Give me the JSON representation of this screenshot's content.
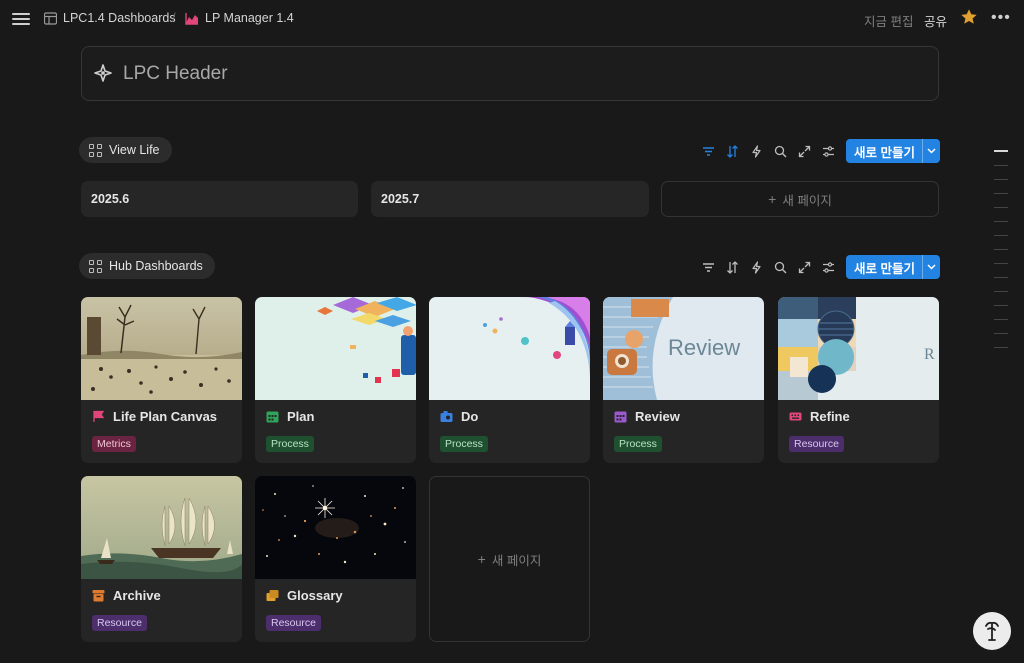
{
  "topbar": {
    "breadcrumb_1": "LPC1.4 Dashboards",
    "breadcrumb_sep": "/",
    "breadcrumb_2": "LP Manager 1.4",
    "edited_label": "지금 편집",
    "share_label": "공유",
    "more_label": "•••"
  },
  "header": {
    "title": "LPC Header"
  },
  "view_life": {
    "title": "View Life",
    "new_button": "새로 만들기",
    "cards": [
      {
        "label": "2025.6"
      },
      {
        "label": "2025.7"
      }
    ],
    "new_page": "새 페이지"
  },
  "hub": {
    "title": "Hub Dashboards",
    "new_button": "새로 만들기",
    "cards": [
      {
        "title": "Life Plan Canvas",
        "tag": "Metrics",
        "icon": "flag-icon",
        "icon_color": "#e0457b"
      },
      {
        "title": "Plan",
        "tag": "Process",
        "icon": "calendar-icon",
        "icon_color": "#2fa55c"
      },
      {
        "title": "Do",
        "tag": "Process",
        "icon": "camera-icon",
        "icon_color": "#3a80e0"
      },
      {
        "title": "Review",
        "tag": "Process",
        "icon": "calendar-icon",
        "icon_color": "#9b59d0"
      },
      {
        "title": "Refine",
        "tag": "Resource",
        "icon": "keyboard-icon",
        "icon_color": "#e0457b"
      },
      {
        "title": "Archive",
        "tag": "Resource",
        "icon": "archive-icon",
        "icon_color": "#e07a2f"
      },
      {
        "title": "Glossary",
        "tag": "Resource",
        "icon": "folder-icon",
        "icon_color": "#e0a02f"
      }
    ],
    "review_thumb_text": "Review",
    "refine_thumb_text": "R",
    "new_page": "새 페이지"
  },
  "colors": {
    "accent": "#2383e2",
    "background": "#191919"
  }
}
